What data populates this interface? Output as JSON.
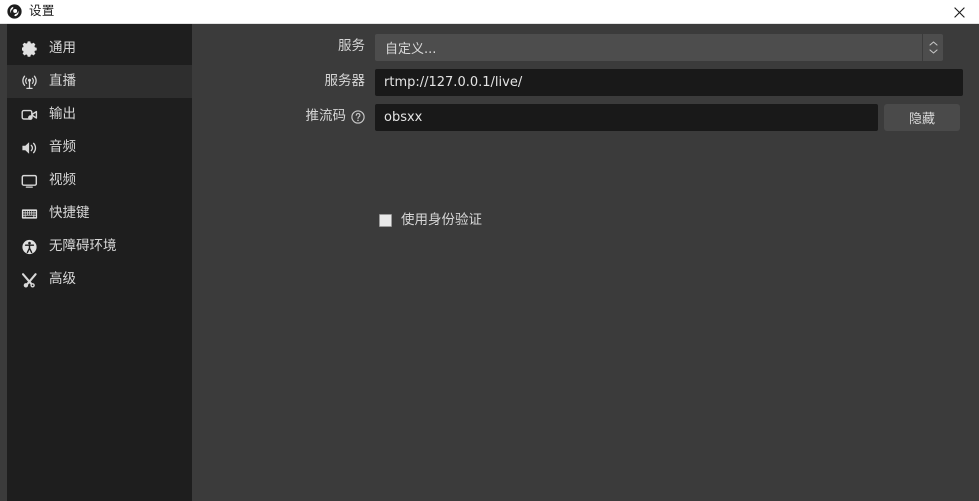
{
  "window": {
    "title": "设置",
    "logo_icon": "obs-logo-icon",
    "close_icon": "close-icon",
    "close_label": "关闭"
  },
  "sidebar": {
    "items": [
      {
        "label": "通用",
        "icon": "gear-icon",
        "selected": false
      },
      {
        "label": "直播",
        "icon": "broadcast-icon",
        "selected": true
      },
      {
        "label": "输出",
        "icon": "video-camera-icon",
        "selected": false
      },
      {
        "label": "音频",
        "icon": "speaker-icon",
        "selected": false
      },
      {
        "label": "视频",
        "icon": "monitor-icon",
        "selected": false
      },
      {
        "label": "快捷键",
        "icon": "keyboard-icon",
        "selected": false
      },
      {
        "label": "无障碍环境",
        "icon": "accessibility-icon",
        "selected": false
      },
      {
        "label": "高级",
        "icon": "tools-icon",
        "selected": false
      }
    ]
  },
  "stream_settings": {
    "service": {
      "label": "服务",
      "value": "自定义...",
      "dropdown_icon": "chevron-updown-icon"
    },
    "server": {
      "label": "服务器",
      "value": "rtmp://127.0.0.1/live/",
      "placeholder": ""
    },
    "stream_key": {
      "label": "推流码",
      "help_icon": "question-circle-icon",
      "value": "obsxx",
      "placeholder": "",
      "toggle_button": "隐藏"
    },
    "use_auth": {
      "label": "使用身份验证",
      "checked": false
    }
  },
  "colors": {
    "titlebar_bg": "#ffffff",
    "sidebar_bg": "#1e1e1e",
    "sidebar_selected_bg": "#2e2e2e",
    "panel_bg": "#3b3b3b",
    "input_bg": "#191919",
    "combobox_bg": "#4d4d4d",
    "button_bg": "#4a4a4a",
    "text": "#d6d6d6"
  }
}
